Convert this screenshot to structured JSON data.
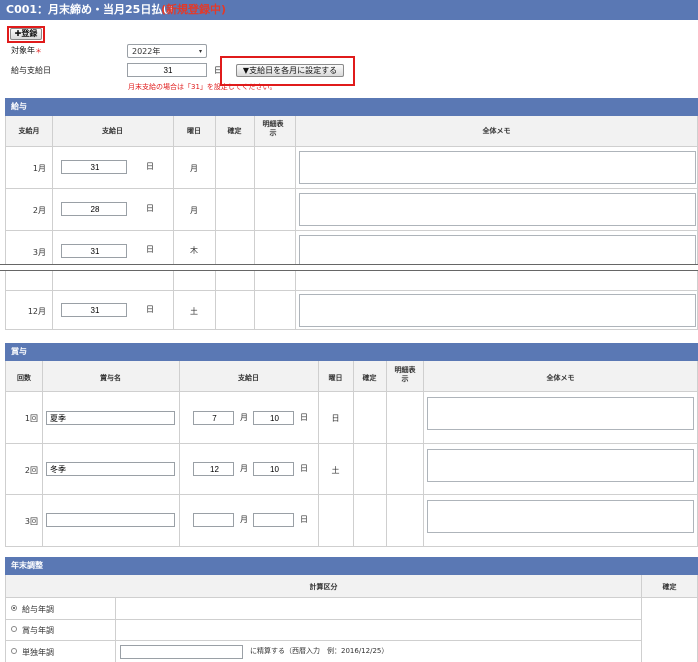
{
  "header": {
    "title": "C001：月末締め・当月25日払い",
    "status": "(新規登録中)"
  },
  "toolbar": {
    "register_label": "✚登録"
  },
  "form": {
    "year_label": "対象年",
    "required_mark": "＊",
    "year_value": "2022年",
    "payday_label": "給与支給日",
    "payday_value": "31",
    "day_unit": "日",
    "apply_button": "▼支給日を各月に設定する",
    "note": "月末支給の場合は「31」を設定してください。"
  },
  "salary": {
    "section_title": "給与",
    "columns": {
      "month": "支給月",
      "payday": "支給日",
      "weekday": "曜日",
      "confirm": "確定",
      "detail": "明細表示",
      "memo": "全体メモ"
    },
    "day_unit": "日",
    "rows": [
      {
        "month": "1月",
        "day": "31",
        "weekday": "月"
      },
      {
        "month": "2月",
        "day": "28",
        "weekday": "月"
      },
      {
        "month": "3月",
        "day": "31",
        "weekday": "木"
      },
      {
        "month": "12月",
        "day": "31",
        "weekday": "土"
      }
    ]
  },
  "bonus": {
    "section_title": "賞与",
    "columns": {
      "count": "回数",
      "name": "賞与名",
      "payday": "支給日",
      "weekday": "曜日",
      "confirm": "確定",
      "detail": "明細表示",
      "memo": "全体メモ"
    },
    "month_unit": "月",
    "day_unit": "日",
    "rows": [
      {
        "count": "1回",
        "name": "夏季",
        "month": "7",
        "day": "10",
        "weekday": "日"
      },
      {
        "count": "2回",
        "name": "冬季",
        "month": "12",
        "day": "10",
        "weekday": "土"
      },
      {
        "count": "3回",
        "name": "",
        "month": "",
        "day": "",
        "weekday": ""
      }
    ]
  },
  "year_end": {
    "section_title": "年末調整",
    "columns": {
      "category": "計算区分",
      "confirm": "確定"
    },
    "options": [
      {
        "label": "給与年調",
        "selected": true
      },
      {
        "label": "賞与年調",
        "selected": false
      },
      {
        "label": "単独年調",
        "selected": false
      }
    ],
    "standalone_suffix": "に精算する（西暦入力　例：2016/12/25）"
  }
}
